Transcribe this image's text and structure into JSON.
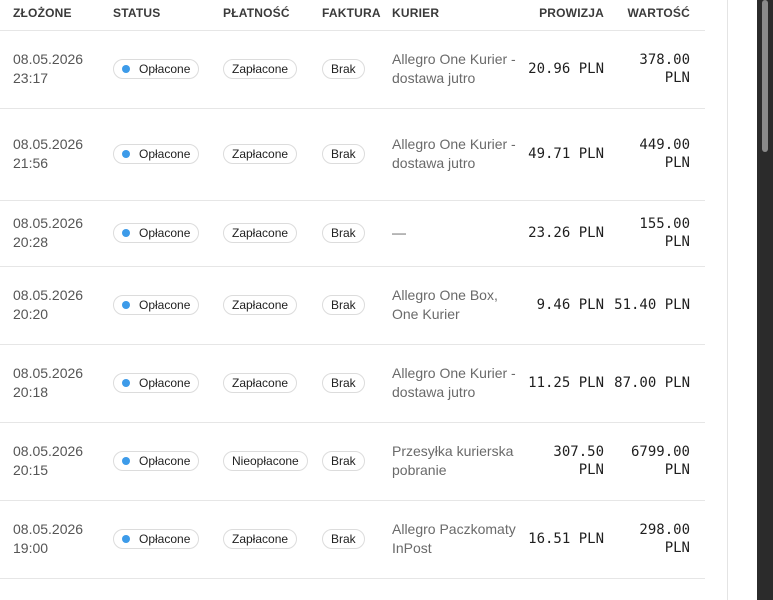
{
  "columns": {
    "placed": "ZŁOŻONE",
    "status": "STATUS",
    "payment": "PŁATNOŚĆ",
    "invoice": "FAKTURA",
    "courier": "KURIER",
    "commission": "PROWIZJA",
    "value": "WARTOŚĆ"
  },
  "accent_color": "#3d9be9",
  "rows": [
    {
      "date": "08.05.2026",
      "time": "23:17",
      "status": "Opłacone",
      "payment": "Zapłacone",
      "invoice": "Brak",
      "courier": "Allegro One Kurier - dostawa jutro",
      "commission": "20.96 PLN",
      "value": "378.00 PLN"
    },
    {
      "date": "08.05.2026",
      "time": "21:56",
      "status": "Opłacone",
      "payment": "Zapłacone",
      "invoice": "Brak",
      "courier": "Allegro One Kurier - dostawa jutro",
      "commission": "49.71 PLN",
      "value": "449.00 PLN"
    },
    {
      "date": "08.05.2026",
      "time": "20:28",
      "status": "Opłacone",
      "payment": "Zapłacone",
      "invoice": "Brak",
      "courier": "—",
      "commission": "23.26 PLN",
      "value": "155.00 PLN"
    },
    {
      "date": "08.05.2026",
      "time": "20:20",
      "status": "Opłacone",
      "payment": "Zapłacone",
      "invoice": "Brak",
      "courier": "Allegro One Box, One Kurier",
      "commission": "9.46 PLN",
      "value": "51.40 PLN"
    },
    {
      "date": "08.05.2026",
      "time": "20:18",
      "status": "Opłacone",
      "payment": "Zapłacone",
      "invoice": "Brak",
      "courier": "Allegro One Kurier - dostawa jutro",
      "commission": "11.25 PLN",
      "value": "87.00 PLN"
    },
    {
      "date": "08.05.2026",
      "time": "20:15",
      "status": "Opłacone",
      "payment": "Nieopłacone",
      "invoice": "Brak",
      "courier": "Przesyłka kurierska pobranie",
      "commission": "307.50 PLN",
      "value": "6799.00 PLN"
    },
    {
      "date": "08.05.2026",
      "time": "19:00",
      "status": "Opłacone",
      "payment": "Zapłacone",
      "invoice": "Brak",
      "courier": "Allegro Paczkomaty InPost",
      "commission": "16.51 PLN",
      "value": "298.00 PLN"
    }
  ]
}
